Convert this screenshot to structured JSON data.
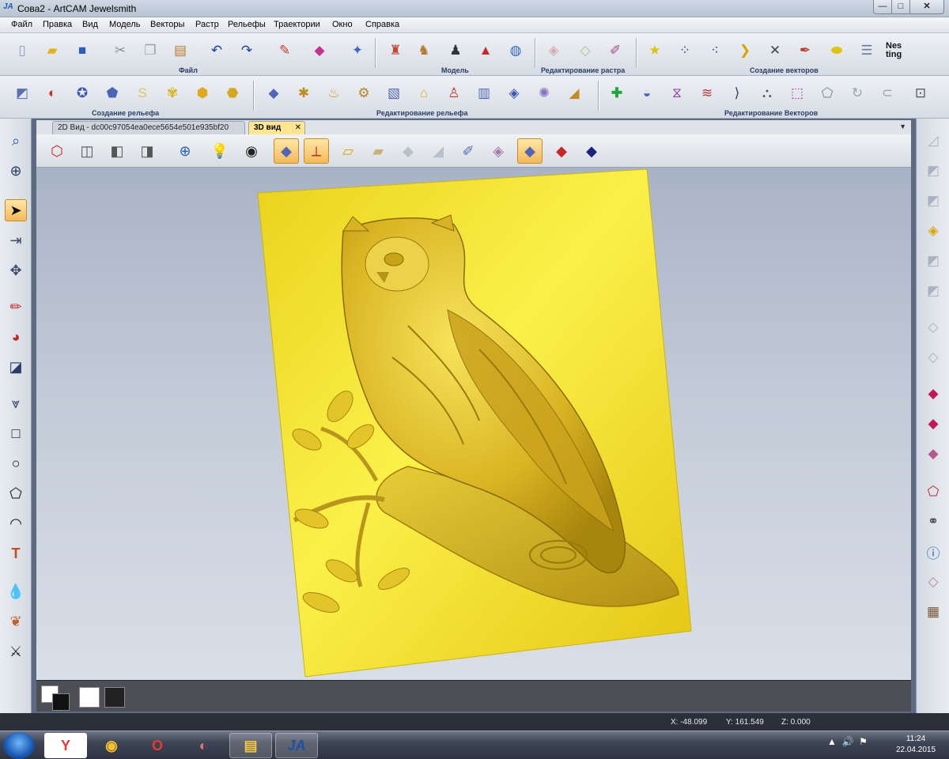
{
  "window": {
    "title": "Сова2 - ArtCAM Jewelsmith",
    "app_icon": "artcam-icon",
    "controls": {
      "minimize": "—",
      "maximize": "□",
      "close": "✕"
    }
  },
  "menu": [
    "Файл",
    "Правка",
    "Вид",
    "Модель",
    "Векторы",
    "Растр",
    "Рельефы",
    "Траектории",
    "Окно",
    "Справка"
  ],
  "toolbar_groups": {
    "file": "Файл",
    "model": "Модель",
    "raster_edit": "Редактирование растра",
    "vector_create": "Создание векторов",
    "relief_create": "Создание рельефа",
    "relief_edit": "Редактирование рельефа",
    "vector_edit": "Редактирование Векторов"
  },
  "nesting_label": "Nes ting",
  "tabs": {
    "view2d": "2D Вид - dc00c97054ea0ece5654e501e935bf20",
    "view3d": "3D вид",
    "close": "✕",
    "dropdown": "▼"
  },
  "status": {
    "x": "X: -48.099",
    "y": "Y: 161.549",
    "z": "Z: 0.000"
  },
  "clock": {
    "time": "11:24",
    "date": "22.04.2015"
  },
  "colors": {
    "relief_yellow": "#f2e12a",
    "viewport_bg": "#c3cbd8",
    "active_tab": "#ffe68f"
  }
}
